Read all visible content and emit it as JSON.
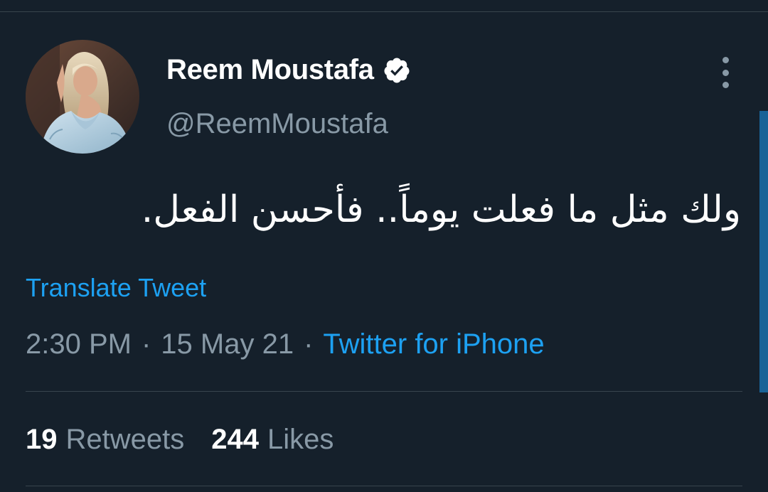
{
  "author": {
    "display_name": "Reem Moustafa",
    "handle": "@ReemMoustafa",
    "verified": true,
    "avatar_icon": "profile-photo"
  },
  "tweet": {
    "text": "ولك مثل ما فعلت يوماً.. فأحسن الفعل.",
    "translate_label": "Translate Tweet",
    "time": "2:30 PM",
    "separator": "·",
    "date": "15 May 21",
    "source": "Twitter for iPhone"
  },
  "stats": {
    "retweets_count": "19",
    "retweets_label": "Retweets",
    "likes_count": "244",
    "likes_label": "Likes"
  },
  "colors": {
    "background": "#15202b",
    "text_primary": "#ffffff",
    "text_secondary": "#8899a6",
    "accent": "#1da1f2",
    "divider": "#38444d"
  },
  "icons": {
    "verified": "verified-badge-icon",
    "more": "more-vertical-icon"
  }
}
